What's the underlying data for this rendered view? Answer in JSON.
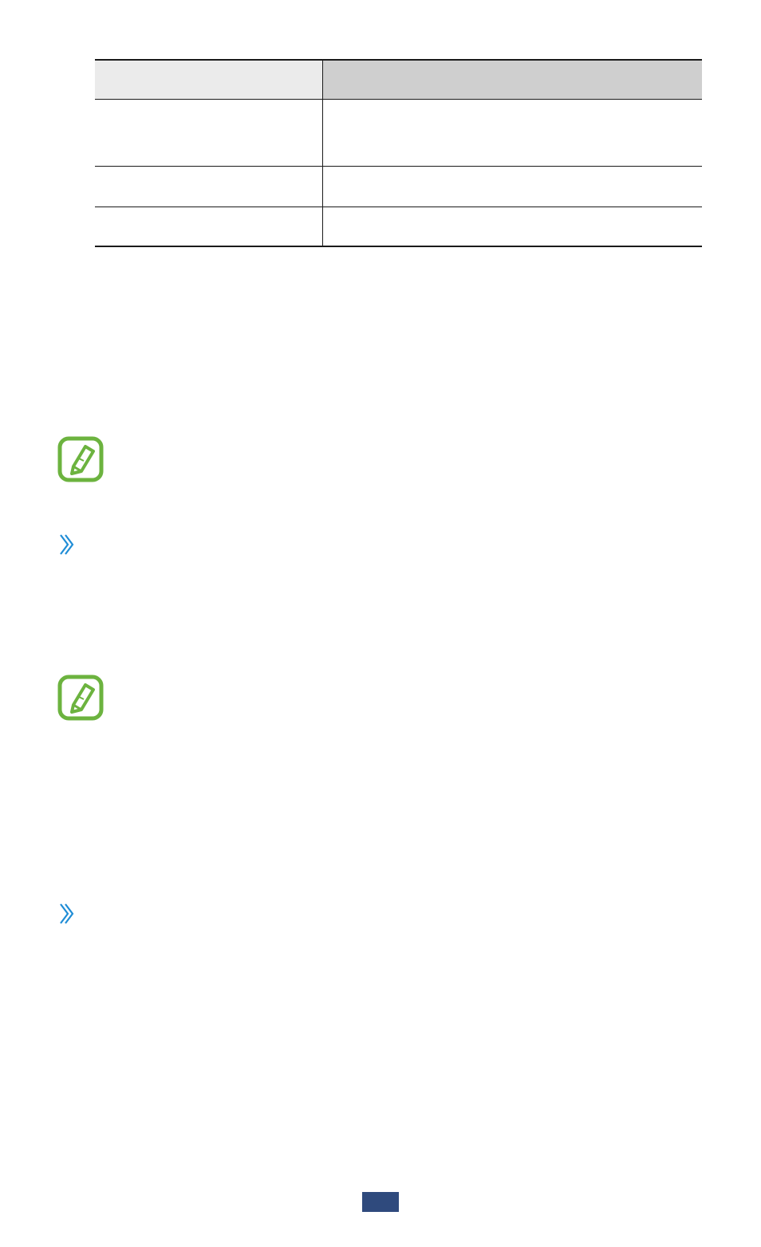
{
  "table": {
    "header": {
      "col1": "",
      "col2": ""
    },
    "rows": [
      {
        "col1": "",
        "col2": ""
      },
      {
        "col1": "",
        "col2": ""
      },
      {
        "col1": "",
        "col2": ""
      }
    ]
  },
  "icons": {
    "note": "note-pencil-icon",
    "section": "chevron-right-double-icon"
  },
  "colors": {
    "note_icon_green": "#6cb33f",
    "chevron_blue": "#1f8dd6",
    "page_tab_blue": "#2f4a7d",
    "table_header_light": "#ebebeb",
    "table_header_dark": "#cfcfcf"
  },
  "footer": {
    "page_number": ""
  }
}
